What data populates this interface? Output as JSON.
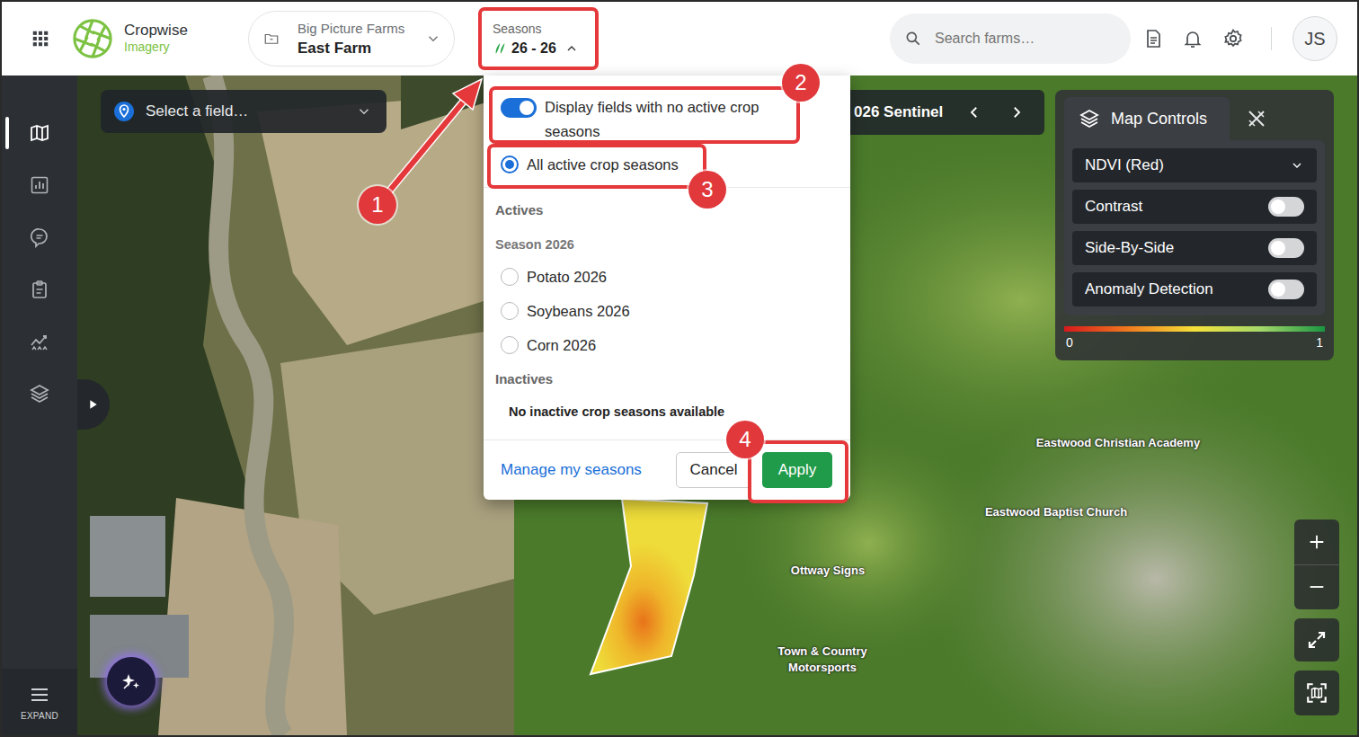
{
  "app": {
    "brand": "Cropwise",
    "product": "Imagery"
  },
  "farm_selector": {
    "group": "Big Picture Farms",
    "farm": "East Farm"
  },
  "seasons_button": {
    "label": "Seasons",
    "value": "26 - 26",
    "expanded": true
  },
  "search": {
    "placeholder": "Search farms…"
  },
  "user": {
    "initials": "JS"
  },
  "sidebar": {
    "items": [
      {
        "selected": true
      },
      {
        "selected": false
      },
      {
        "selected": false
      },
      {
        "selected": false
      },
      {
        "selected": false
      },
      {
        "selected": false
      }
    ],
    "expand_label": "EXPAND"
  },
  "field_select": {
    "placeholder": "Select a field…"
  },
  "imagery_bar": {
    "label": "026 Sentinel"
  },
  "map_controls": {
    "title": "Map Controls",
    "layer": "NDVI (Red)",
    "toggles": [
      {
        "label": "Contrast",
        "on": false
      },
      {
        "label": "Side-By-Side",
        "on": false
      },
      {
        "label": "Anomaly Detection",
        "on": false
      }
    ],
    "legend": {
      "min": "0",
      "max": "1"
    }
  },
  "map_labels": [
    {
      "text": "Eastwood Christian Academy"
    },
    {
      "text": "Eastwood Baptist Church"
    },
    {
      "text": "Ottway Signs"
    },
    {
      "text": "Town & Country Motorsports"
    }
  ],
  "seasons_menu": {
    "show_empty_toggle": {
      "label": "Display fields with no active crop seasons",
      "on": true
    },
    "all_option": {
      "label": "All active crop seasons",
      "selected": true
    },
    "actives_heading": "Actives",
    "season_heading": "Season 2026",
    "seasons": [
      {
        "label": "Potato 2026",
        "selected": false
      },
      {
        "label": "Soybeans 2026",
        "selected": false
      },
      {
        "label": "Corn 2026",
        "selected": false
      }
    ],
    "inactives_heading": "Inactives",
    "inactives_empty": "No inactive crop seasons available",
    "manage_link": "Manage my seasons",
    "buttons": [
      "Cancel",
      "Apply"
    ]
  },
  "annotations": [
    {
      "number": "1"
    },
    {
      "number": "2"
    },
    {
      "number": "3"
    },
    {
      "number": "4"
    }
  ]
}
